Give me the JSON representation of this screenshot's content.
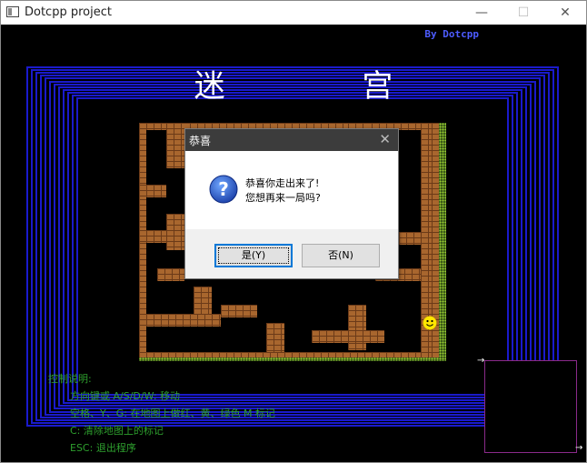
{
  "window": {
    "title": "Dotcpp project",
    "min_glyph": "—",
    "max_glyph": "☐",
    "close_glyph": "✕"
  },
  "game": {
    "by_label": "By Dotcpp",
    "title": "迷 宫"
  },
  "dialog": {
    "title": "恭喜",
    "close_glyph": "✕",
    "icon": "question-icon",
    "message_line1": "恭喜你走出来了!",
    "message_line2": "您想再来一局吗?",
    "yes_label": "是(Y)",
    "no_label": "否(N)"
  },
  "controls": {
    "heading": "控制说明:",
    "lines": [
      "方向键或 A/S/D/W: 移动",
      "空格、Y、G: 在地图上做红、黄、绿色 M 标记",
      "C: 清除地图上的标记",
      "ESC: 退出程序"
    ]
  },
  "colors": {
    "frame_blue": "#1a1acc",
    "brick": "#a8662e",
    "controls_text": "#2ea02e",
    "by_label": "#4d5cff"
  }
}
